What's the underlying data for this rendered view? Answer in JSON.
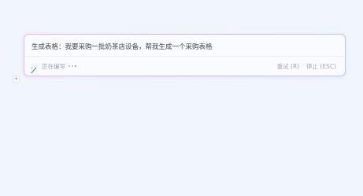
{
  "ai_writer": {
    "prompt": "生成表格：我要采购一批奶茶店设备，帮我生成一个采购表格",
    "status": "正在编写",
    "retry_label": "重试 (R)",
    "stop_label": "停止 (ESC)"
  },
  "editor": {
    "add_block_symbol": "+"
  },
  "icons": {
    "status": "sparkle-pen-icon",
    "add": "plus-icon"
  },
  "colors": {
    "page_background": "#f1f5fe",
    "card_border_start": "#e7b8f4",
    "card_border_end": "#b7c9f7",
    "sparkle_icon": "#4f7cf0",
    "muted_text": "#a3a9b4"
  }
}
